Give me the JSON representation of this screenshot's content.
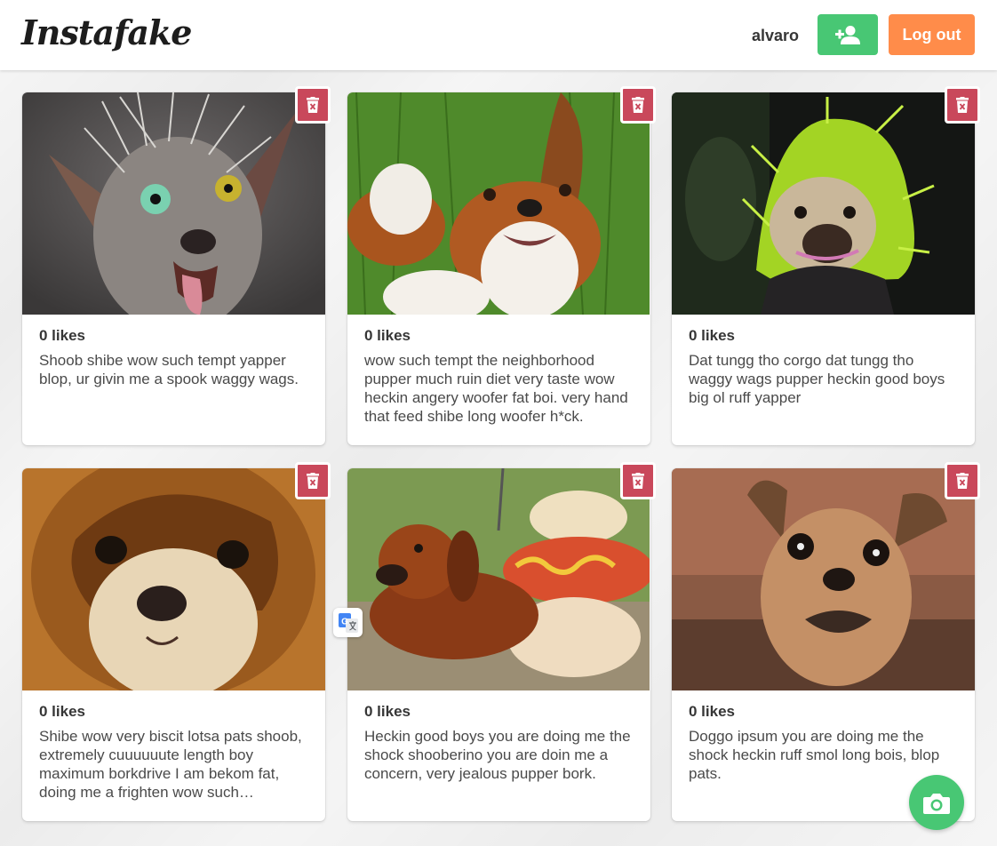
{
  "header": {
    "logo": "Instafake",
    "username": "alvaro",
    "add_user_icon": "person-add-icon",
    "logout_label": "Log out"
  },
  "colors": {
    "green": "#48c774",
    "orange": "#ff8c4a",
    "delete_red": "#c9485b"
  },
  "posts": [
    {
      "likes": "0 likes",
      "caption": "Shoob shibe wow such tempt yapper blop, ur givin me a spook waggy wags.",
      "image": "hairless-dog-photo"
    },
    {
      "likes": "0 likes",
      "caption": "wow such tempt the neighborhood pupper much ruin diet very taste wow heckin angery woofer fat boi. very hand that feed shibe long woofer h*ck.",
      "image": "beagle-on-grass-photo"
    },
    {
      "likes": "0 likes",
      "caption": "Dat tungg tho corgo dat tungg tho waggy wags pupper heckin good boys big ol ruff yapper",
      "image": "pug-green-wig-photo"
    },
    {
      "likes": "0 likes",
      "caption": "Shibe wow very biscit lotsa pats shoob, extremely cuuuuuute length boy maximum borkdrive I am bekom fat, doing me a frighten wow such…",
      "image": "chihuahua-wig-photo"
    },
    {
      "likes": "0 likes",
      "caption": "Heckin good boys you are doing me the shock shooberino you are doin me a concern, very jealous pupper bork.",
      "image": "dachshund-hotdog-photo"
    },
    {
      "likes": "0 likes",
      "caption": "Doggo ipsum you are doing me the shock heckin ruff smol long bois, blop pats.",
      "image": "pug-mix-photo"
    }
  ],
  "icons": {
    "delete": "trash-icon",
    "translate": "google-translate-icon",
    "camera": "camera-icon"
  }
}
